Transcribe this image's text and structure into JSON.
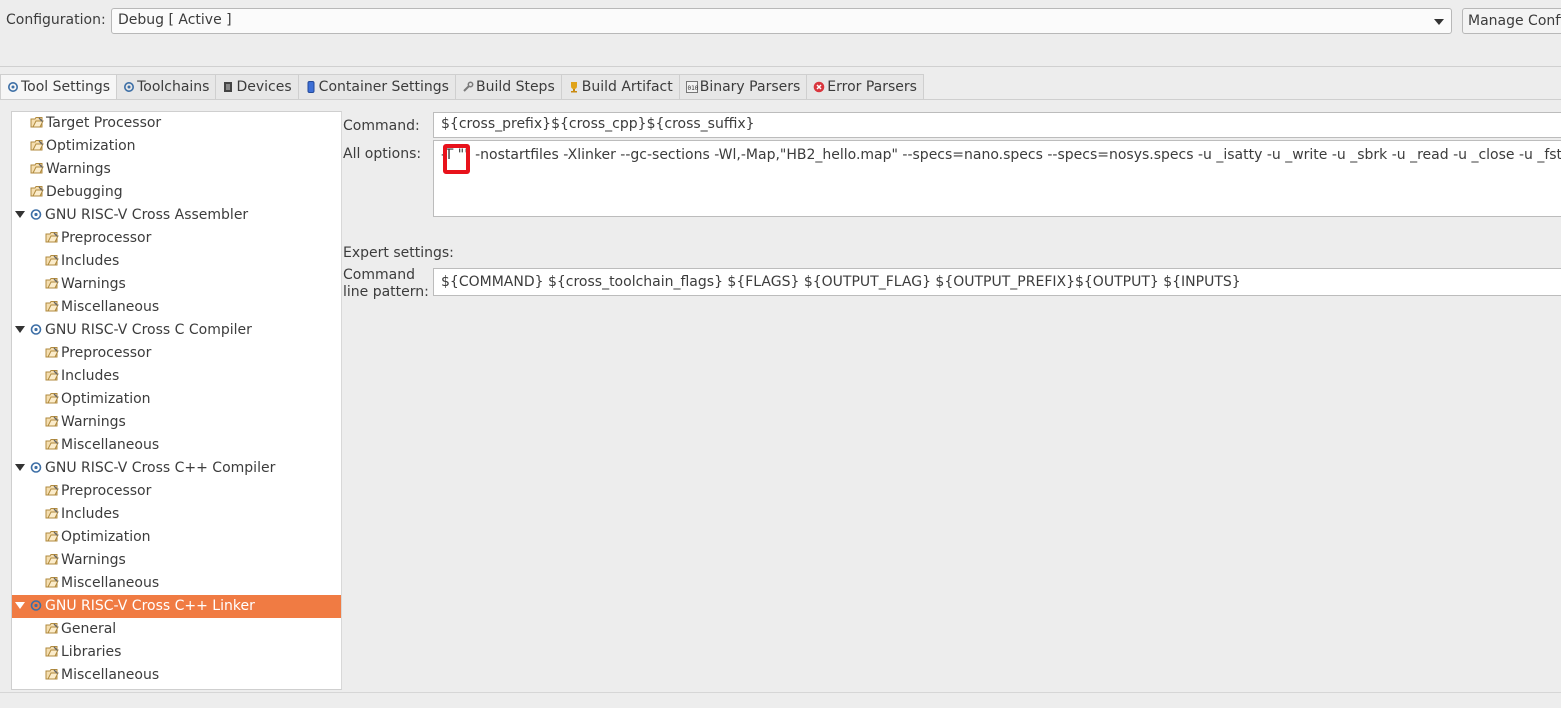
{
  "config": {
    "label": "Configuration:",
    "value": "Debug  [ Active ]",
    "manage_button": "Manage Configurations..."
  },
  "tabs": [
    {
      "label": "Tool Settings",
      "icon": "gear-icon",
      "active": true
    },
    {
      "label": "Toolchains",
      "icon": "gear-icon"
    },
    {
      "label": "Devices",
      "icon": "chip-icon"
    },
    {
      "label": "Container Settings",
      "icon": "container-icon"
    },
    {
      "label": "Build Steps",
      "icon": "wrench-icon"
    },
    {
      "label": "Build Artifact",
      "icon": "trophy-icon"
    },
    {
      "label": "Binary Parsers",
      "icon": "binary-icon"
    },
    {
      "label": "Error Parsers",
      "icon": "error-icon"
    }
  ],
  "tree": [
    {
      "label": "Target Processor",
      "level": 1
    },
    {
      "label": "Optimization",
      "level": 1
    },
    {
      "label": "Warnings",
      "level": 1
    },
    {
      "label": "Debugging",
      "level": 1
    },
    {
      "label": "GNU RISC-V Cross Assembler",
      "level": 0
    },
    {
      "label": "Preprocessor",
      "level": 2
    },
    {
      "label": "Includes",
      "level": 2
    },
    {
      "label": "Warnings",
      "level": 2
    },
    {
      "label": "Miscellaneous",
      "level": 2
    },
    {
      "label": "GNU RISC-V Cross C Compiler",
      "level": 0
    },
    {
      "label": "Preprocessor",
      "level": 2
    },
    {
      "label": "Includes",
      "level": 2
    },
    {
      "label": "Optimization",
      "level": 2
    },
    {
      "label": "Warnings",
      "level": 2
    },
    {
      "label": "Miscellaneous",
      "level": 2
    },
    {
      "label": "GNU RISC-V Cross C++ Compiler",
      "level": 0
    },
    {
      "label": "Preprocessor",
      "level": 2
    },
    {
      "label": "Includes",
      "level": 2
    },
    {
      "label": "Optimization",
      "level": 2
    },
    {
      "label": "Warnings",
      "level": 2
    },
    {
      "label": "Miscellaneous",
      "level": 2
    },
    {
      "label": "GNU RISC-V Cross C++ Linker",
      "level": 0,
      "selected": true
    },
    {
      "label": "General",
      "level": 2
    },
    {
      "label": "Libraries",
      "level": 2
    },
    {
      "label": "Miscellaneous",
      "level": 2
    }
  ],
  "panel": {
    "command_label": "Command:",
    "command_value": "${cross_prefix}${cross_cpp}${cross_suffix}",
    "all_options_label": "All options:",
    "all_options_value": "-T \"\" -nostartfiles -Xlinker --gc-sections -Wl,-Map,\"HB2_hello.map\" --specs=nano.specs --specs=nosys.specs -u _isatty -u _write -u _sbrk -u _read -u _close -u _fstat -u _lseek",
    "expert_label": "Expert settings:",
    "pattern_label_line1": "Command",
    "pattern_label_line2": "line pattern:",
    "pattern_value": "${COMMAND} ${cross_toolchain_flags} ${FLAGS} ${OUTPUT_FLAG} ${OUTPUT_PREFIX}${OUTPUT} ${INPUTS}"
  },
  "colors": {
    "selection": "#f07b43",
    "highlight_box": "#e8121b"
  }
}
